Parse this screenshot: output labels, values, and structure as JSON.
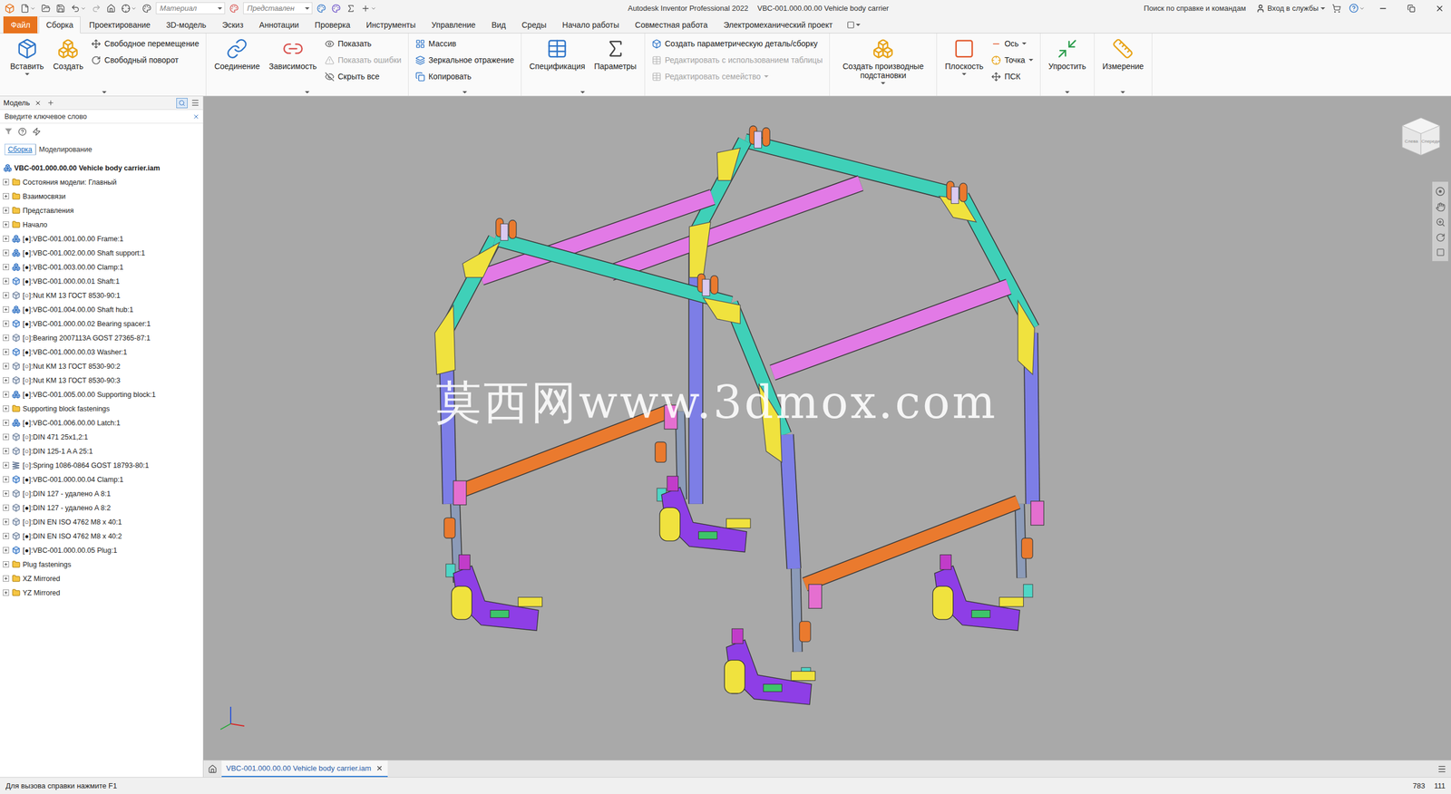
{
  "window": {
    "title": "Autodesk Inventor Professional 2022",
    "document": "VBC-001.000.00.00 Vehicle body carrier"
  },
  "quick_access": {
    "material": "Материал",
    "appearance": "Представлен"
  },
  "help_search": {
    "placeholder": "Поиск по справке и командам"
  },
  "account": {
    "label": "Вход в службы"
  },
  "menu_tabs": [
    {
      "label": "Файл",
      "kind": "file",
      "selected": false
    },
    {
      "label": "Сборка",
      "kind": "tab",
      "selected": true
    },
    {
      "label": "Проектирование",
      "kind": "tab",
      "selected": false
    },
    {
      "label": "3D-модель",
      "kind": "tab",
      "selected": false
    },
    {
      "label": "Эскиз",
      "kind": "tab",
      "selected": false
    },
    {
      "label": "Аннотации",
      "kind": "tab",
      "selected": false
    },
    {
      "label": "Проверка",
      "kind": "tab",
      "selected": false
    },
    {
      "label": "Инструменты",
      "kind": "tab",
      "selected": false
    },
    {
      "label": "Управление",
      "kind": "tab",
      "selected": false
    },
    {
      "label": "Вид",
      "kind": "tab",
      "selected": false
    },
    {
      "label": "Среды",
      "kind": "tab",
      "selected": false
    },
    {
      "label": "Начало работы",
      "kind": "tab",
      "selected": false
    },
    {
      "label": "Совместная работа",
      "kind": "tab",
      "selected": false
    },
    {
      "label": "Электромеханический проект",
      "kind": "tab",
      "selected": false
    }
  ],
  "ribbon": {
    "panels": [
      {
        "has_menu": true,
        "large": [
          {
            "label": "Вставить",
            "dropdown": true
          },
          {
            "label": "Создать",
            "dropdown": false
          }
        ],
        "small": [
          {
            "label": "Свободное перемещение",
            "disabled": false,
            "dropdown": false
          },
          {
            "label": "Свободный поворот",
            "disabled": false,
            "dropdown": false
          }
        ]
      },
      {
        "has_menu": true,
        "large": [
          {
            "label": "Соединение",
            "dropdown": false
          },
          {
            "label": "Зависимость",
            "dropdown": false
          }
        ],
        "small": [
          {
            "label": "Показать",
            "disabled": false,
            "dropdown": false
          },
          {
            "label": "Показать ошибки",
            "disabled": true,
            "dropdown": false
          },
          {
            "label": "Скрыть все",
            "disabled": false,
            "dropdown": false
          }
        ]
      },
      {
        "has_menu": true,
        "large": [],
        "small": [
          {
            "label": "Массив",
            "disabled": false,
            "dropdown": false
          },
          {
            "label": "Зеркальное отражение",
            "disabled": false,
            "dropdown": false
          },
          {
            "label": "Копировать",
            "disabled": false,
            "dropdown": false
          }
        ]
      },
      {
        "has_menu": true,
        "large": [
          {
            "label": "Спецификация",
            "dropdown": false
          },
          {
            "label": "Параметры",
            "dropdown": false
          }
        ],
        "small": []
      },
      {
        "has_menu": false,
        "large": [],
        "small": [
          {
            "label": "Создать параметрическую деталь/сборку",
            "disabled": false,
            "dropdown": false
          },
          {
            "label": "Редактировать с использованием таблицы",
            "disabled": true,
            "dropdown": false
          },
          {
            "label": "Редактировать семейство",
            "disabled": true,
            "dropdown": true
          }
        ]
      },
      {
        "has_menu": false,
        "large": [
          {
            "label": "Создать производные подстановки",
            "dropdown": true
          }
        ],
        "small": []
      },
      {
        "has_menu": false,
        "large": [
          {
            "label": "Плоскость",
            "dropdown": true
          }
        ],
        "small": [
          {
            "label": "Ось",
            "disabled": false,
            "dropdown": true
          },
          {
            "label": "Точка",
            "disabled": false,
            "dropdown": true
          },
          {
            "label": "ПСК",
            "disabled": false,
            "dropdown": false
          }
        ]
      },
      {
        "has_menu": true,
        "large": [
          {
            "label": "Упростить",
            "dropdown": false
          }
        ],
        "small": []
      },
      {
        "has_menu": true,
        "large": [
          {
            "label": "Измерение",
            "dropdown": false
          }
        ],
        "small": []
      }
    ]
  },
  "browser": {
    "tab": "Модель",
    "search_placeholder": "Введите ключевое слово",
    "modes": [
      {
        "label": "Сборка",
        "selected": true
      },
      {
        "label": "Моделирование",
        "selected": false
      }
    ],
    "tree": [
      {
        "label": "VBC-001.000.00.00 Vehicle body carrier.iam",
        "kind": "root",
        "expanded": true
      },
      {
        "label": "Состояния модели: Главный",
        "kind": "folder",
        "expanded": false
      },
      {
        "label": "Взаимосвязи",
        "kind": "folder",
        "expanded": false
      },
      {
        "label": "Представления",
        "kind": "folder",
        "expanded": false
      },
      {
        "label": "Начало",
        "kind": "folder",
        "expanded": false
      },
      {
        "label": "[●]:VBC-001.001.00.00 Frame:1",
        "kind": "assembly",
        "expanded": false
      },
      {
        "label": "[●]:VBC-001.002.00.00 Shaft support:1",
        "kind": "assembly",
        "expanded": false
      },
      {
        "label": "[●]:VBC-001.003.00.00 Clamp:1",
        "kind": "assembly",
        "expanded": false
      },
      {
        "label": "[●]:VBC-001.000.00.01 Shaft:1",
        "kind": "part",
        "expanded": false
      },
      {
        "label": "[○]:Nut KM 13 ГОСТ 8530-90:1",
        "kind": "content",
        "expanded": false
      },
      {
        "label": "[●]:VBC-001.004.00.00 Shaft hub:1",
        "kind": "assembly",
        "expanded": false
      },
      {
        "label": "[●]:VBC-001.000.00.02 Bearing spacer:1",
        "kind": "part",
        "expanded": false
      },
      {
        "label": "[○]:Bearing 2007113A GOST 27365-87:1",
        "kind": "content",
        "expanded": false
      },
      {
        "label": "[●]:VBC-001.000.00.03 Washer:1",
        "kind": "part",
        "expanded": false
      },
      {
        "label": "[○]:Nut KM 13 ГОСТ 8530-90:2",
        "kind": "content",
        "expanded": false
      },
      {
        "label": "[○]:Nut KM 13 ГОСТ 8530-90:3",
        "kind": "content",
        "expanded": false
      },
      {
        "label": "[●]:VBC-001.005.00.00 Supporting block:1",
        "kind": "assembly",
        "expanded": false
      },
      {
        "label": "Supporting block fastenings",
        "kind": "folder",
        "expanded": false
      },
      {
        "label": "[●]:VBC-001.006.00.00 Latch:1",
        "kind": "assembly",
        "expanded": false
      },
      {
        "label": "[○]:DIN 471 25x1,2:1",
        "kind": "content",
        "expanded": false
      },
      {
        "label": "[○]:DIN 125-1 A A 25:1",
        "kind": "content",
        "expanded": false
      },
      {
        "label": "[○]:Spring 1086-0864 GOST 18793-80:1",
        "kind": "spring",
        "expanded": false
      },
      {
        "label": "[●]:VBC-001.000.00.04 Clamp:1",
        "kind": "part",
        "expanded": false
      },
      {
        "label": "[○]:DIN 127 - удалено A 8:1",
        "kind": "content",
        "expanded": false
      },
      {
        "label": "[●]:DIN 127 - удалено A 8:2",
        "kind": "content",
        "expanded": false
      },
      {
        "label": "[○]:DIN EN ISO 4762 M8 x 40:1",
        "kind": "content",
        "expanded": false
      },
      {
        "label": "[●]:DIN EN ISO 4762 M8 x 40:2",
        "kind": "content",
        "expanded": false
      },
      {
        "label": "[●]:VBC-001.000.00.05 Plug:1",
        "kind": "part",
        "expanded": false
      },
      {
        "label": "Plug fastenings",
        "kind": "folder",
        "expanded": false
      },
      {
        "label": "XZ Mirrored",
        "kind": "folder",
        "expanded": false
      },
      {
        "label": "YZ Mirrored",
        "kind": "folder",
        "expanded": false
      }
    ]
  },
  "viewport": {
    "watermark": "莫西网www.3dmox.com",
    "viewcube": {
      "left": "Слева",
      "front": "Спереди"
    }
  },
  "document_tabs": [
    {
      "label": "VBC-001.000.00.00 Vehicle body carrier.iam",
      "selected": true
    }
  ],
  "status_bar": {
    "hint": "Для вызова справки нажмите F1",
    "counts": [
      "783",
      "111"
    ]
  }
}
